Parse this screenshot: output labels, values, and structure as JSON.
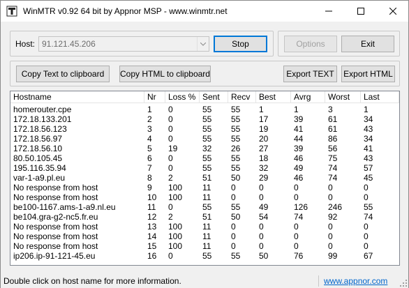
{
  "window": {
    "title": "WinMTR v0.92 64 bit by Appnor MSP - www.winmtr.net"
  },
  "host": {
    "label": "Host:",
    "value": "91.121.45.206"
  },
  "buttons": {
    "stop": "Stop",
    "options": "Options",
    "exit": "Exit",
    "copy_text": "Copy Text to clipboard",
    "copy_html": "Copy HTML to clipboard",
    "export_text": "Export TEXT",
    "export_html": "Export HTML"
  },
  "table": {
    "columns": [
      "Hostname",
      "Nr",
      "Loss %",
      "Sent",
      "Recv",
      "Best",
      "Avrg",
      "Worst",
      "Last"
    ],
    "rows": [
      [
        "homerouter.cpe",
        "1",
        "0",
        "55",
        "55",
        "1",
        "1",
        "3",
        "1"
      ],
      [
        "172.18.133.201",
        "2",
        "0",
        "55",
        "55",
        "17",
        "39",
        "61",
        "34"
      ],
      [
        "172.18.56.123",
        "3",
        "0",
        "55",
        "55",
        "19",
        "41",
        "61",
        "43"
      ],
      [
        "172.18.56.97",
        "4",
        "0",
        "55",
        "55",
        "20",
        "44",
        "86",
        "34"
      ],
      [
        "172.18.56.10",
        "5",
        "19",
        "32",
        "26",
        "27",
        "39",
        "56",
        "41"
      ],
      [
        "80.50.105.45",
        "6",
        "0",
        "55",
        "55",
        "18",
        "46",
        "75",
        "43"
      ],
      [
        "195.116.35.94",
        "7",
        "0",
        "55",
        "55",
        "32",
        "49",
        "74",
        "57"
      ],
      [
        "var-1-a9.pl.eu",
        "8",
        "2",
        "51",
        "50",
        "29",
        "46",
        "74",
        "45"
      ],
      [
        "No response from host",
        "9",
        "100",
        "11",
        "0",
        "0",
        "0",
        "0",
        "0"
      ],
      [
        "No response from host",
        "10",
        "100",
        "11",
        "0",
        "0",
        "0",
        "0",
        "0"
      ],
      [
        "be100-1167.ams-1-a9.nl.eu",
        "11",
        "0",
        "55",
        "55",
        "49",
        "126",
        "246",
        "55"
      ],
      [
        "be104.gra-g2-nc5.fr.eu",
        "12",
        "2",
        "51",
        "50",
        "54",
        "74",
        "92",
        "74"
      ],
      [
        "No response from host",
        "13",
        "100",
        "11",
        "0",
        "0",
        "0",
        "0",
        "0"
      ],
      [
        "No response from host",
        "14",
        "100",
        "11",
        "0",
        "0",
        "0",
        "0",
        "0"
      ],
      [
        "No response from host",
        "15",
        "100",
        "11",
        "0",
        "0",
        "0",
        "0",
        "0"
      ],
      [
        "ip206.ip-91-121-45.eu",
        "16",
        "0",
        "55",
        "55",
        "50",
        "76",
        "99",
        "67"
      ]
    ]
  },
  "status": {
    "hint": "Double click on host name for more information.",
    "link": "www.appnor.com"
  },
  "colors": {
    "accent": "#0078d7",
    "link": "#0066cc"
  }
}
